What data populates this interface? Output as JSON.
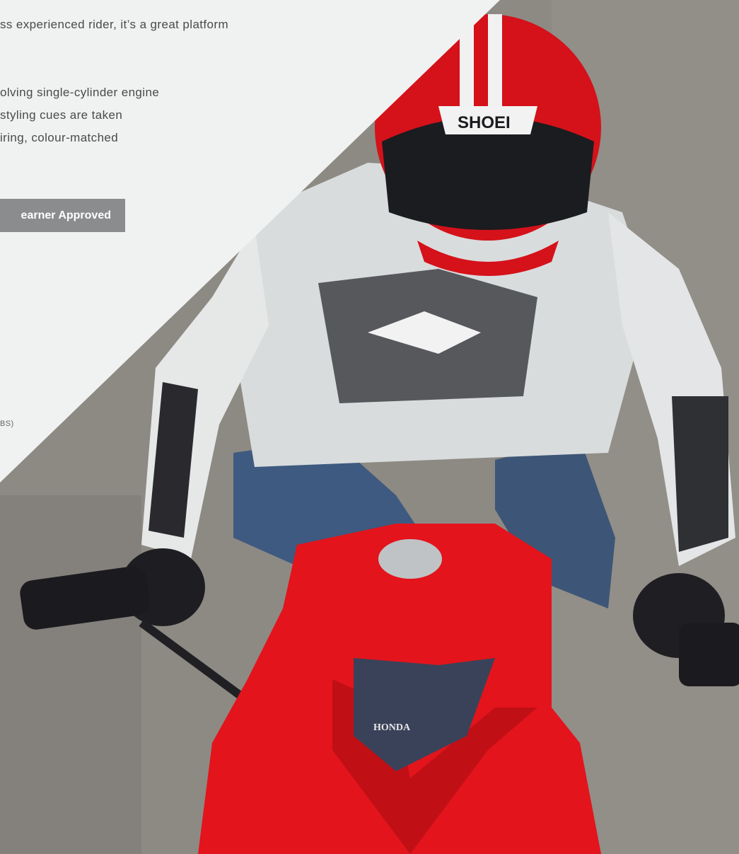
{
  "panel": {
    "lines": [
      "ss experienced rider, it’s a great platform",
      "olving single-cylinder engine",
      "styling cues are taken",
      "iring, colour-matched"
    ],
    "badge_label": "earner Approved",
    "abs_fragment": "BS)"
  },
  "photo": {
    "helmet_brand": "SHOEI",
    "bike_brand": "HONDA",
    "subject": "rider-on-red-motorcycle"
  }
}
